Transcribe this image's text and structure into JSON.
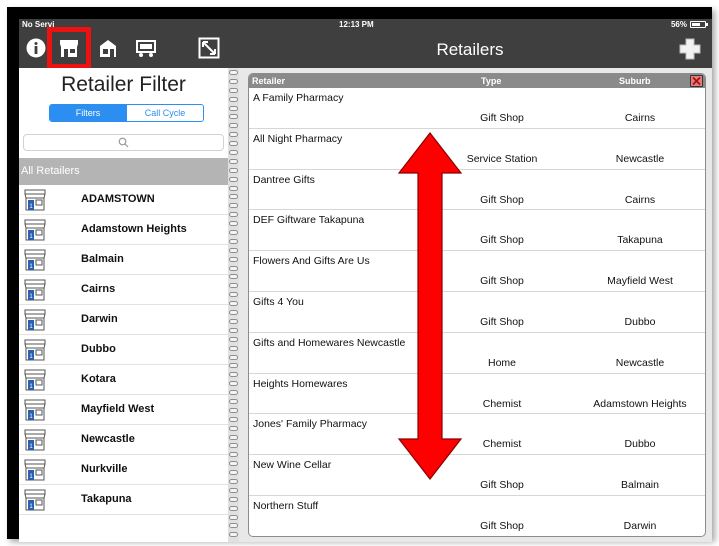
{
  "status_bar": {
    "carrier": "No Servi",
    "time": "12:13 PM",
    "battery": "56%"
  },
  "toolbar": {
    "icons": [
      "info-icon",
      "storefront-icon",
      "retailer-card-icon",
      "cart-icon",
      "expand-icon"
    ]
  },
  "header": {
    "title": "Retailers",
    "add_icon": "plus-icon"
  },
  "filter": {
    "title": "Retailer Filter",
    "tabs": [
      "Filters",
      "Call Cycle"
    ],
    "active_tab": "Filters",
    "search_placeholder": "",
    "all_label": "All Retailers",
    "suburbs": [
      {
        "label": "ADAMSTOWN"
      },
      {
        "label": "Adamstown Heights"
      },
      {
        "label": "Balmain"
      },
      {
        "label": "Cairns"
      },
      {
        "label": "Darwin"
      },
      {
        "label": "Dubbo"
      },
      {
        "label": "Kotara"
      },
      {
        "label": "Mayfield West"
      },
      {
        "label": "Newcastle"
      },
      {
        "label": "Nurkville"
      },
      {
        "label": "Takapuna"
      }
    ]
  },
  "table": {
    "columns": [
      "Retailer",
      "Type",
      "Suburb"
    ],
    "rows": [
      {
        "name": "A Family Pharmacy",
        "type": "Gift Shop",
        "suburb": "Cairns"
      },
      {
        "name": "All Night Pharmacy",
        "type": "Service Station",
        "suburb": "Newcastle"
      },
      {
        "name": "Dantree Gifts",
        "type": "Gift Shop",
        "suburb": "Cairns"
      },
      {
        "name": "DEF Giftware Takapuna",
        "type": "Gift Shop",
        "suburb": "Takapuna"
      },
      {
        "name": "Flowers And Gifts Are Us",
        "type": "Gift Shop",
        "suburb": "Mayfield West"
      },
      {
        "name": "Gifts 4 You",
        "type": "Gift Shop",
        "suburb": "Dubbo"
      },
      {
        "name": "Gifts and Homewares Newcastle",
        "type": "Home",
        "suburb": "Newcastle"
      },
      {
        "name": "Heights Homewares",
        "type": "Chemist",
        "suburb": "Adamstown Heights"
      },
      {
        "name": "Jones' Family Pharmacy",
        "type": "Chemist",
        "suburb": "Dubbo"
      },
      {
        "name": "New Wine Cellar",
        "type": "Gift Shop",
        "suburb": "Balmain"
      },
      {
        "name": "Northern Stuff",
        "type": "Gift Shop",
        "suburb": "Darwin"
      }
    ]
  },
  "colors": {
    "toolbar_bg": "#3f3f3f",
    "accent_blue": "#2b8ef0",
    "highlight_red": "#ee1111",
    "arrow_red": "#ff0000"
  }
}
